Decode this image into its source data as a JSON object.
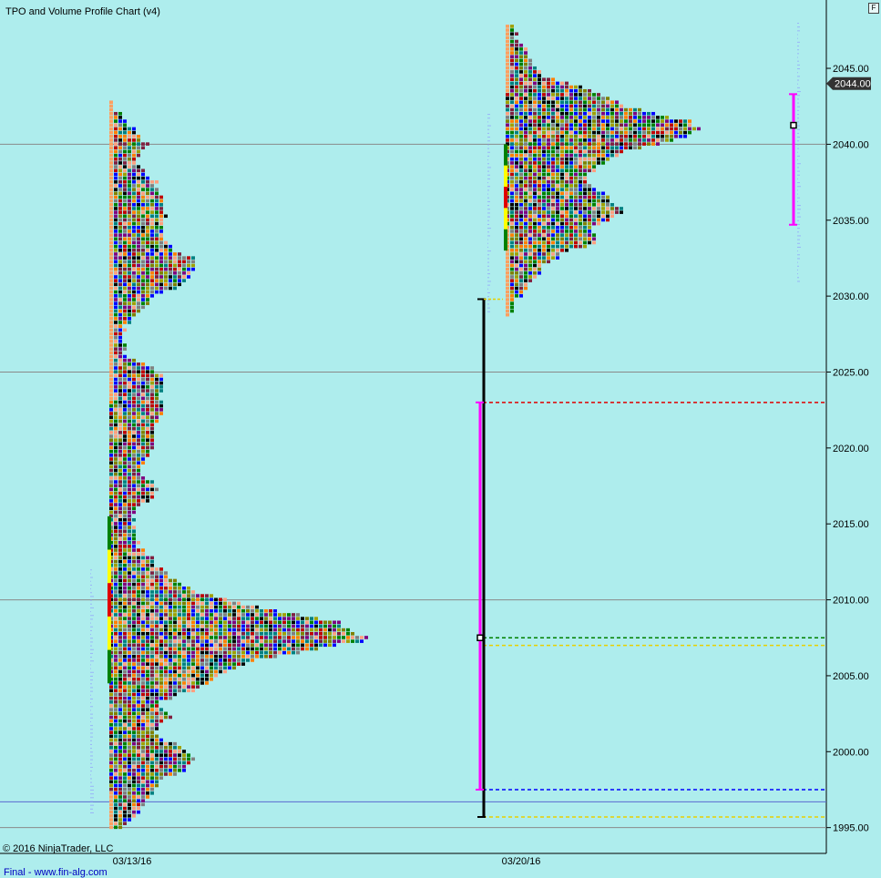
{
  "title": "TPO and Volume Profile Chart (v4)",
  "copyright": "© 2016 NinjaTrader, LLC",
  "footer": "Final - www.fin-alg.com",
  "corner_button": "F",
  "colors": {
    "background": "#aeeded",
    "gridline": "#8a8a8a",
    "magenta": "#ff00ff",
    "red_dash": "#e00000",
    "green_dash": "#008000",
    "yellow_dash": "#e8d000",
    "blue_dash": "#0000ff",
    "footer_link": "#0000c0",
    "tpo_palette": [
      "#000000",
      "#c00000",
      "#0000ff",
      "#008000",
      "#ff7f00",
      "#7f007f",
      "#808000",
      "#808080",
      "#ffa080",
      "#008080",
      "#802040",
      "#a0a000"
    ]
  },
  "chart_data": {
    "type": "tpo-profile",
    "yaxis": {
      "ylim": [
        1993.3,
        2049.5
      ],
      "ticks": [
        "1995.00",
        "2000.00",
        "2005.00",
        "2010.00",
        "2015.00",
        "2020.00",
        "2025.00",
        "2030.00",
        "2035.00",
        "2040.00",
        "2045.00"
      ],
      "current_price_label": "2044.00",
      "current_price": 2044.0
    },
    "xaxis": {
      "date_labels": [
        "03/13/16",
        "03/20/16"
      ]
    },
    "gridlines": [
      1995.0,
      2010.0,
      2025.0,
      2040.0
    ],
    "blue_hline": 1996.7,
    "sessions": [
      {
        "date": "03/13/16",
        "low": 1995.0,
        "high": 2042.75,
        "poc": 2007.5,
        "value_area_high": 2023.0,
        "value_area_low": 1997.5,
        "initial_balance_high": 2029.8,
        "initial_balance_low": 1995.7,
        "profile_widths": [
          [
            1995.0,
            3
          ],
          [
            1996.0,
            6
          ],
          [
            1997.0,
            9
          ],
          [
            1998.0,
            11
          ],
          [
            1998.75,
            16
          ],
          [
            1999.25,
            18
          ],
          [
            1999.75,
            19
          ],
          [
            2000.5,
            15
          ],
          [
            2001.0,
            11
          ],
          [
            2001.5,
            10
          ],
          [
            2002.0,
            12
          ],
          [
            2002.25,
            14
          ],
          [
            2002.75,
            11
          ],
          [
            2003.25,
            12
          ],
          [
            2004.0,
            18
          ],
          [
            2004.5,
            22
          ],
          [
            2005.25,
            26
          ],
          [
            2006.0,
            32
          ],
          [
            2006.5,
            42
          ],
          [
            2007.0,
            50
          ],
          [
            2007.25,
            56
          ],
          [
            2007.5,
            57
          ],
          [
            2008.0,
            53
          ],
          [
            2008.5,
            50
          ],
          [
            2009.0,
            42
          ],
          [
            2009.5,
            32
          ],
          [
            2010.0,
            26
          ],
          [
            2010.5,
            20
          ],
          [
            2011.25,
            14
          ],
          [
            2012.0,
            12
          ],
          [
            2012.5,
            10
          ],
          [
            2013.0,
            8
          ],
          [
            2014.0,
            6
          ],
          [
            2015.0,
            5
          ],
          [
            2016.0,
            6
          ],
          [
            2016.5,
            9
          ],
          [
            2017.25,
            11
          ],
          [
            2018.0,
            8
          ],
          [
            2018.5,
            7
          ],
          [
            2019.5,
            9
          ],
          [
            2020.5,
            10
          ],
          [
            2021.75,
            11
          ],
          [
            2022.5,
            12
          ],
          [
            2023.5,
            11
          ],
          [
            2024.5,
            12
          ],
          [
            2025.25,
            10
          ],
          [
            2026.0,
            4
          ],
          [
            2027.0,
            3
          ],
          [
            2028.0,
            4
          ],
          [
            2029.0,
            7
          ],
          [
            2030.0,
            10
          ],
          [
            2030.75,
            17
          ],
          [
            2031.5,
            18
          ],
          [
            2032.0,
            19
          ],
          [
            2032.5,
            18
          ],
          [
            2033.0,
            14
          ],
          [
            2034.0,
            12
          ],
          [
            2035.0,
            12
          ],
          [
            2036.0,
            12
          ],
          [
            2037.0,
            11
          ],
          [
            2037.5,
            10
          ],
          [
            2038.0,
            8
          ],
          [
            2038.75,
            6
          ],
          [
            2039.25,
            7
          ],
          [
            2040.0,
            8
          ],
          [
            2040.5,
            7
          ],
          [
            2041.25,
            5
          ],
          [
            2042.0,
            2
          ],
          [
            2042.75,
            1
          ]
        ]
      },
      {
        "date": "03/20/16",
        "low": 2028.75,
        "high": 2047.75,
        "poc": 2041.25,
        "value_area_high": 2043.3,
        "value_area_low": 2034.7,
        "initial_balance_high": 2041.2,
        "initial_balance_low": 2040.5,
        "profile_widths": [
          [
            2028.75,
            1
          ],
          [
            2029.5,
            2
          ],
          [
            2030.25,
            4
          ],
          [
            2031.0,
            6
          ],
          [
            2032.0,
            9
          ],
          [
            2033.0,
            14
          ],
          [
            2033.5,
            21
          ],
          [
            2034.0,
            20
          ],
          [
            2034.5,
            19
          ],
          [
            2035.0,
            23
          ],
          [
            2035.5,
            26
          ],
          [
            2036.0,
            24
          ],
          [
            2036.5,
            22
          ],
          [
            2037.0,
            20
          ],
          [
            2037.75,
            17
          ],
          [
            2038.5,
            20
          ],
          [
            2039.0,
            24
          ],
          [
            2039.5,
            26
          ],
          [
            2040.0,
            33
          ],
          [
            2040.5,
            40
          ],
          [
            2041.0,
            42
          ],
          [
            2041.5,
            40
          ],
          [
            2042.0,
            33
          ],
          [
            2042.5,
            27
          ],
          [
            2043.0,
            23
          ],
          [
            2043.5,
            19
          ],
          [
            2044.0,
            13
          ],
          [
            2044.5,
            9
          ],
          [
            2045.25,
            6
          ],
          [
            2046.0,
            5
          ],
          [
            2046.5,
            4
          ],
          [
            2047.0,
            3
          ],
          [
            2047.75,
            2
          ]
        ]
      }
    ],
    "horizontal_dashed_levels": [
      {
        "color": "red",
        "value": 2023.0
      },
      {
        "color": "green",
        "value": 2007.5
      },
      {
        "color": "yellow",
        "value": 2007.0
      },
      {
        "color": "blue",
        "value": 1997.5
      },
      {
        "color": "yellow",
        "value": 1995.7
      }
    ]
  }
}
